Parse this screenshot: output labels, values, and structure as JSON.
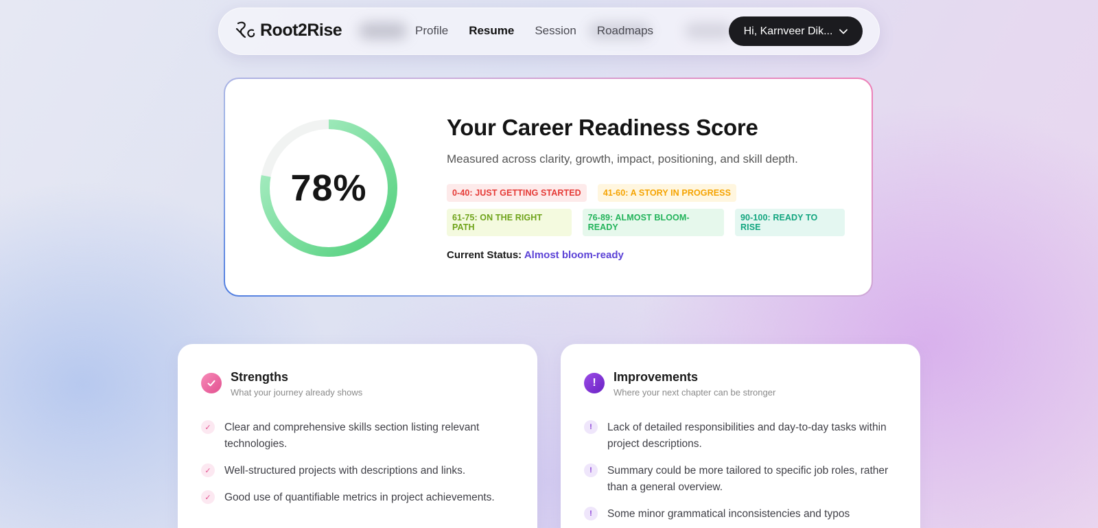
{
  "nav": {
    "brand": "Root2Rise",
    "links": [
      "Profile",
      "Resume",
      "Session",
      "Roadmaps"
    ],
    "active_link": "Resume",
    "user_label": "Hi, Karnveer Dik..."
  },
  "score": {
    "percent_label": "78%",
    "percent_value": 78,
    "title": "Your Career Readiness Score",
    "subtitle": "Measured across clarity, growth, impact, positioning, and skill depth.",
    "badges": [
      {
        "label": "0-40: JUST GETTING STARTED",
        "color": "#e53935",
        "bg": "#fdeaea"
      },
      {
        "label": "41-60: A STORY IN PROGRESS",
        "color": "#f5a300",
        "bg": "#fff6df"
      },
      {
        "label": "61-75: ON THE RIGHT PATH",
        "color": "#6fa31a",
        "bg": "#f4fadf"
      },
      {
        "label": "76-89: ALMOST BLOOM-READY",
        "color": "#22b35a",
        "bg": "#e6f8ec"
      },
      {
        "label": "90-100: READY TO RISE",
        "color": "#12a57f",
        "bg": "#e4f7f1"
      }
    ],
    "status_label": "Current Status:",
    "status_value": "Almost bloom-ready"
  },
  "strengths": {
    "title": "Strengths",
    "subtitle": "What your journey already shows",
    "items": [
      "Clear and comprehensive skills section listing relevant technologies.",
      "Well-structured projects with descriptions and links.",
      "Good use of quantifiable metrics in project achievements."
    ]
  },
  "improvements": {
    "title": "Improvements",
    "subtitle": "Where your next chapter can be stronger",
    "items": [
      "Lack of detailed responsibilities and day-to-day tasks within project descriptions.",
      "Summary could be more tailored to specific job roles, rather than a general overview.",
      "Some minor grammatical inconsistencies and typos"
    ]
  },
  "icons": {
    "strength_bullet": "✓",
    "improvement_bullet": "!"
  },
  "colors": {
    "ring_start": "#4fcf7a",
    "ring_end": "#b4f0cc",
    "status_accent": "#5b42d6",
    "strength_accent": "#ec5c9a",
    "improvement_accent": "#7b2fd0"
  }
}
